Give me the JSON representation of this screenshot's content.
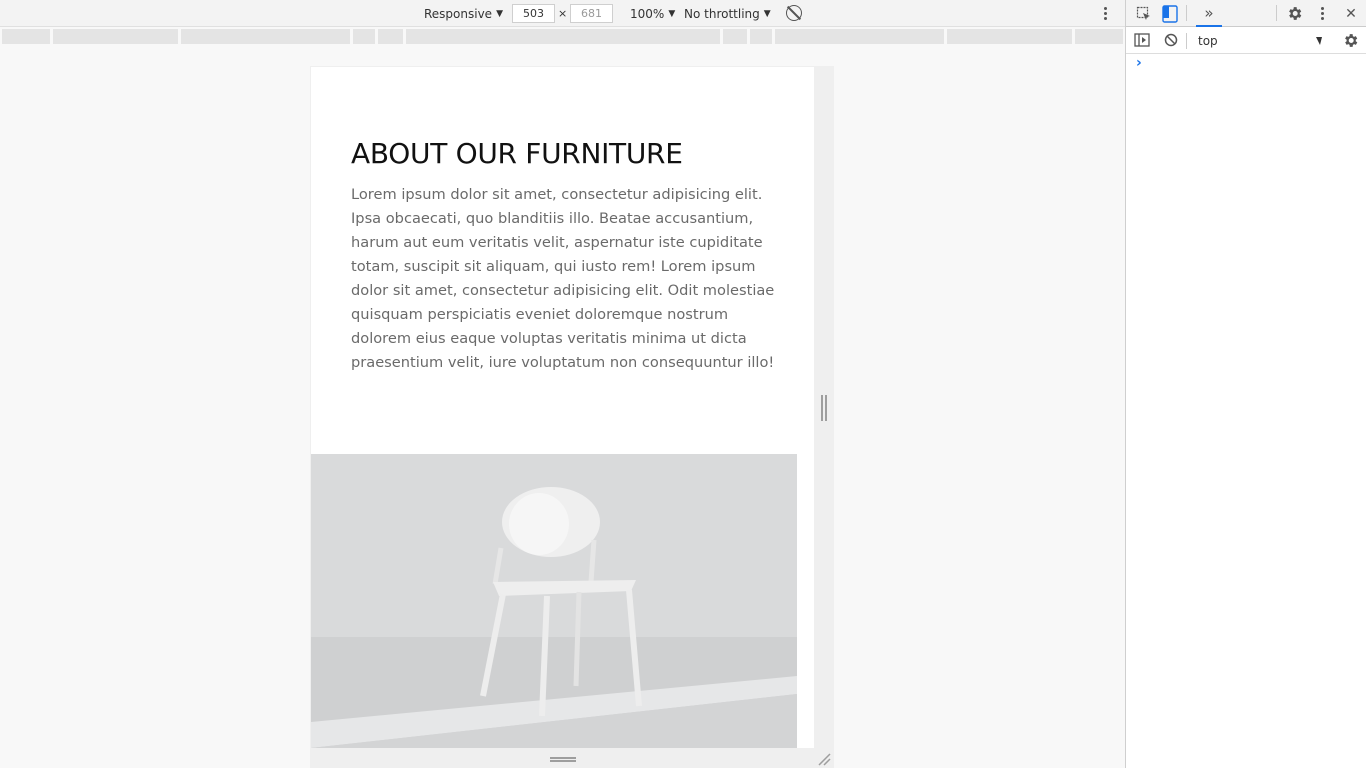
{
  "toolbar": {
    "device_mode": "Responsive",
    "width_value": "503",
    "height_value": "681",
    "times_sign": "×",
    "zoom": "100%",
    "throttling": "No throttling",
    "caret": "▼"
  },
  "page": {
    "heading": "ABOUT OUR FURNITURE",
    "body": "Lorem ipsum dolor sit amet, consectetur adipisicing elit. Ipsa obcaecati, quo blanditiis illo. Beatae accusantium, harum aut eum veritatis velit, aspernatur iste cupiditate totam, suscipit sit aliquam, qui iusto rem! Lorem ipsum dolor sit amet, consectetur adipisicing elit. Odit molestiae quisquam perspiciatis eveniet doloremque nostrum dolorem eius eaque voluptas veritatis minima ut dicta praesentium velit, iure voluptatum non consequuntur illo!"
  },
  "devtools": {
    "more_tabs": "»",
    "close": "✕",
    "context": "top",
    "prompt": "›"
  },
  "colors": {
    "accent": "#1a73e8",
    "image_bg": "#d6d7d8"
  }
}
